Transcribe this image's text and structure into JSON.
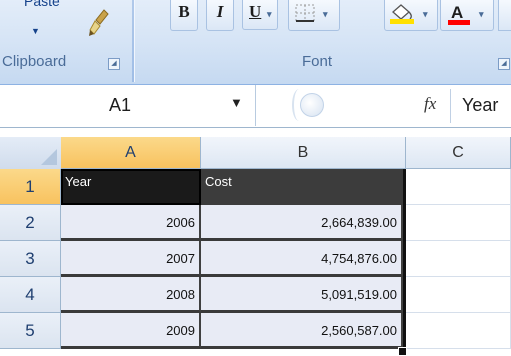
{
  "ribbon": {
    "clipboard": {
      "paste_label": "Paste",
      "group_label": "Clipboard",
      "launcher": "◢"
    },
    "font": {
      "bold_label": "B",
      "italic_label": "I",
      "underline_label": "U",
      "dropdown_arrow": "▾",
      "group_label": "Font",
      "launcher": "◢",
      "fill_color": "#ffe000",
      "font_color": "#ff0000"
    }
  },
  "formula_bar": {
    "name_box": "A1",
    "fx_label": "fx",
    "content": "Year"
  },
  "sheet": {
    "columns": [
      "A",
      "B",
      "C"
    ],
    "rows": [
      "1",
      "2",
      "3",
      "4",
      "5"
    ],
    "header": [
      "Year",
      "Cost"
    ],
    "data": [
      [
        "2006",
        "2,664,839.00"
      ],
      [
        "2007",
        "4,754,876.00"
      ],
      [
        "2008",
        "5,091,519.00"
      ],
      [
        "2009",
        "2,560,587.00"
      ]
    ]
  }
}
